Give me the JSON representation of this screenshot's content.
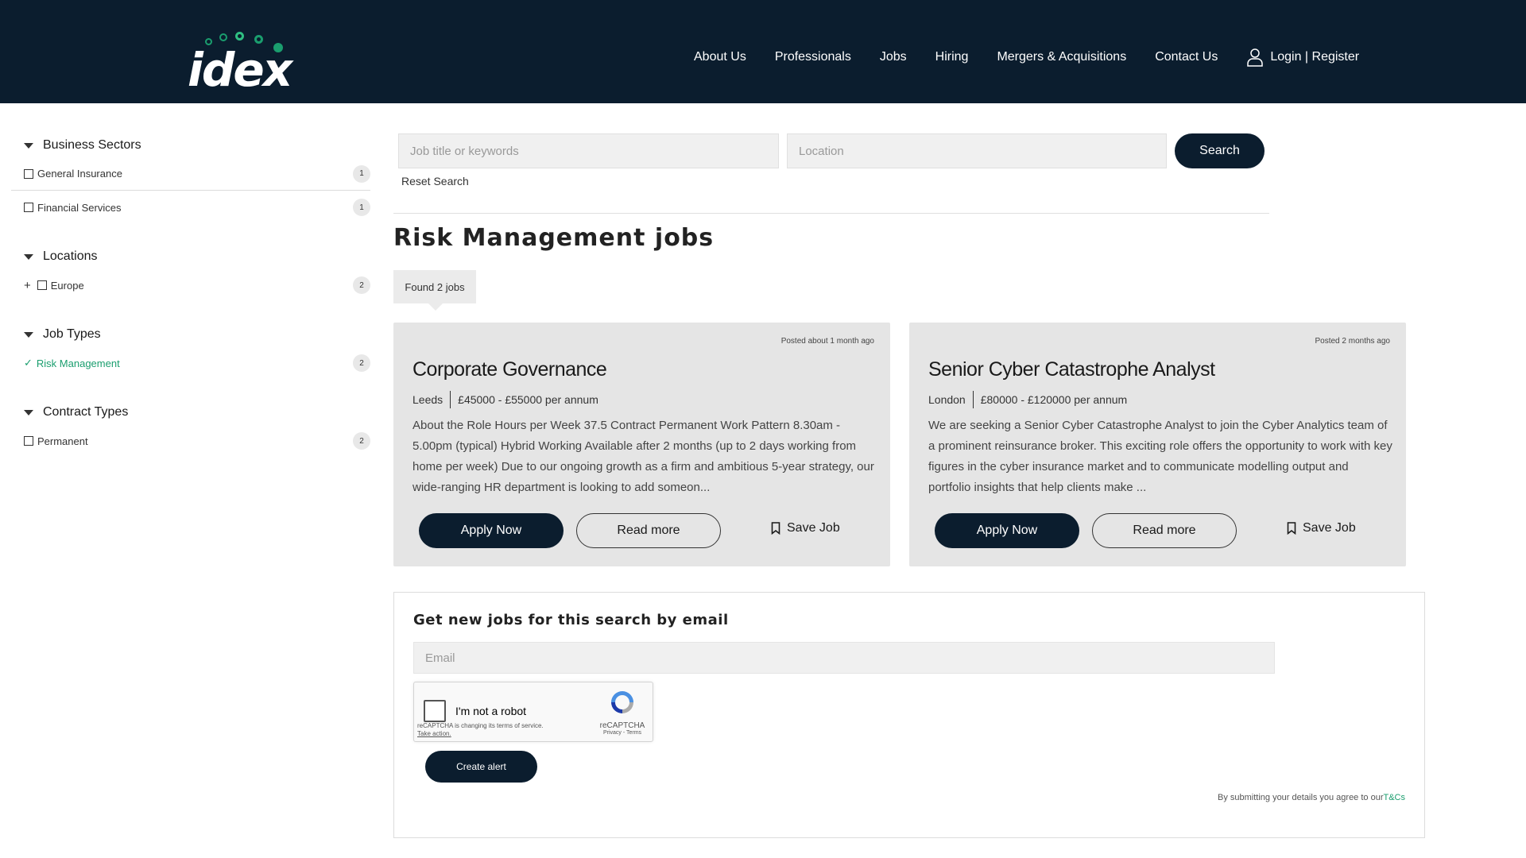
{
  "header": {
    "logo_text": "idex",
    "nav": [
      "About Us",
      "Professionals",
      "Jobs",
      "Hiring",
      "Mergers & Acquisitions",
      "Contact Us"
    ],
    "login_label": "Login | Register",
    "colors": {
      "background": "#0b1d2e",
      "accent_green": "#1a9e6e"
    }
  },
  "sidebar": {
    "business_sectors": {
      "title": "Business Sectors",
      "items": [
        {
          "label": "General Insurance",
          "count": "1"
        },
        {
          "label": "Financial Services",
          "count": "1"
        }
      ]
    },
    "locations": {
      "title": "Locations",
      "items": [
        {
          "label": "Europe",
          "count": "2"
        }
      ]
    },
    "job_types": {
      "title": "Job Types",
      "items": [
        {
          "label": "Risk Management",
          "count": "2"
        }
      ]
    },
    "contract_types": {
      "title": "Contract Types",
      "items": [
        {
          "label": "Permanent",
          "count": "2"
        }
      ]
    }
  },
  "search": {
    "keywords_placeholder": "Job title or keywords",
    "location_placeholder": "Location",
    "button_label": "Search",
    "reset_label": "Reset Search"
  },
  "main": {
    "title": "Risk Management jobs",
    "found_label": "Found 2 jobs"
  },
  "jobs": [
    {
      "posted": "Posted about 1 month ago",
      "title": "Corporate Governance",
      "location": "Leeds",
      "salary": "£45000 - £55000 per annum",
      "description": "About the Role Hours per Week 37.5 Contract Permanent Work Pattern 8.30am - 5.00pm (typical) Hybrid Working Available after 2 months (up to 2 days working from home per week) Due to our ongoing growth as a firm and ambitious 5-year strategy, our wide-ranging HR department is looking to add someon...",
      "apply_label": "Apply Now",
      "read_label": "Read more",
      "save_label": "Save Job"
    },
    {
      "posted": "Posted 2 months ago",
      "title": "Senior Cyber Catastrophe Analyst",
      "location": "London",
      "salary": "£80000 - £120000 per annum",
      "description": "We are seeking a Senior Cyber Catastrophe Analyst to join the Cyber Analytics team of a prominent reinsurance broker. This exciting role offers the opportunity to work with key figures in the cyber insurance market and to communicate modelling output and portfolio insights that help clients make ...",
      "apply_label": "Apply Now",
      "read_label": "Read more",
      "save_label": "Save Job"
    }
  ],
  "alert": {
    "title": "Get new jobs for this search by email",
    "email_placeholder": "Email",
    "recaptcha_label": "I'm not a robot",
    "recaptcha_notice": "reCAPTCHA is changing its terms of service.",
    "recaptcha_action": "Take action.",
    "recaptcha_brand": "reCAPTCHA",
    "recaptcha_links": "Privacy - Terms",
    "create_label": "Create alert",
    "terms_text": "By submitting your details you agree to our",
    "terms_link": "T&Cs"
  }
}
